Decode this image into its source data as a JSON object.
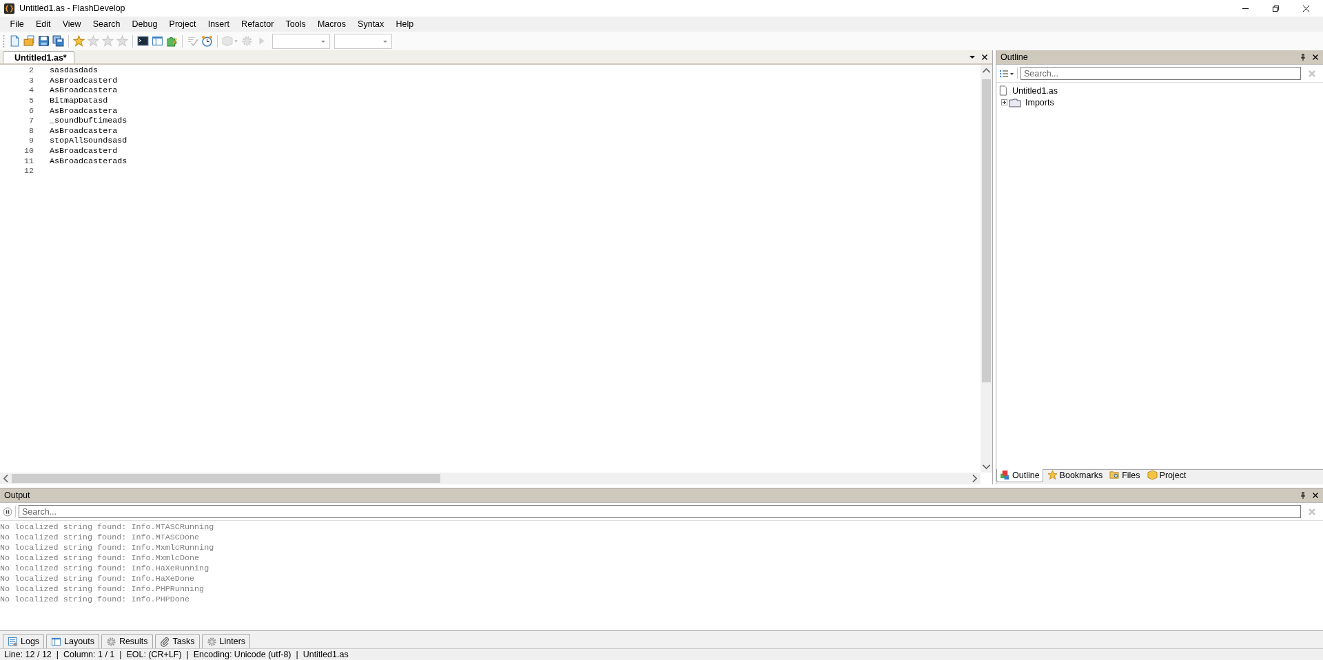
{
  "window": {
    "title": "Untitled1.as - FlashDevelop"
  },
  "menu": [
    "File",
    "Edit",
    "View",
    "Search",
    "Debug",
    "Project",
    "Insert",
    "Refactor",
    "Tools",
    "Macros",
    "Syntax",
    "Help"
  ],
  "toolbar": [
    {
      "kind": "new",
      "disabled": false
    },
    {
      "kind": "open",
      "disabled": false
    },
    {
      "kind": "save",
      "disabled": false
    },
    {
      "kind": "saveall",
      "disabled": false
    },
    {
      "kind": "sep"
    },
    {
      "kind": "star",
      "disabled": false
    },
    {
      "kind": "star",
      "disabled": true
    },
    {
      "kind": "star",
      "disabled": true
    },
    {
      "kind": "star",
      "disabled": true
    },
    {
      "kind": "sep"
    },
    {
      "kind": "terminal",
      "disabled": false
    },
    {
      "kind": "panel",
      "disabled": false
    },
    {
      "kind": "puzzle",
      "disabled": false
    },
    {
      "kind": "sep"
    },
    {
      "kind": "checklist",
      "disabled": true
    },
    {
      "kind": "clock",
      "disabled": false
    },
    {
      "kind": "sep"
    },
    {
      "kind": "box",
      "disabled": true
    },
    {
      "kind": "gear",
      "disabled": true
    },
    {
      "kind": "play",
      "disabled": true
    },
    {
      "kind": "combo"
    },
    {
      "kind": "combo"
    }
  ],
  "editor": {
    "tabs": [
      {
        "label": "Untitled1.as*",
        "selected": true
      }
    ],
    "lines": [
      {
        "number": "2",
        "text": "sasdasdads"
      },
      {
        "number": "3",
        "text": "AsBroadcasterd"
      },
      {
        "number": "4",
        "text": "AsBroadcastera"
      },
      {
        "number": "5",
        "text": "BitmapDatasd"
      },
      {
        "number": "6",
        "text": "AsBroadcastera"
      },
      {
        "number": "7",
        "text": "_soundbuftimeads"
      },
      {
        "number": "8",
        "text": "AsBroadcastera"
      },
      {
        "number": "9",
        "text": "stopAllSoundsasd"
      },
      {
        "number": "10",
        "text": "AsBroadcasterd"
      },
      {
        "number": "11",
        "text": "AsBroadcasterads"
      },
      {
        "number": "12"
      }
    ]
  },
  "outline": {
    "title": "Outline",
    "search": {
      "placeholder": "Search..."
    },
    "tree": [
      {
        "label": "Untitled1.as",
        "kind": "file",
        "children": [
          {
            "label": "Imports",
            "kind": "folder",
            "expanded": false
          }
        ]
      }
    ],
    "tabs": [
      {
        "label": "Outline",
        "kind": "cubes",
        "selected": true
      },
      {
        "label": "Bookmarks",
        "kind": "star",
        "selected": false
      },
      {
        "label": "Files",
        "kind": "folder",
        "selected": false
      },
      {
        "label": "Project",
        "kind": "box",
        "selected": false
      }
    ]
  },
  "output": {
    "title": "Output",
    "search": {
      "placeholder": "Search..."
    },
    "lines": [
      "No localized string found: Info.MTASCRunning",
      "No localized string found: Info.MTASCDone",
      "No localized string found: Info.MxmlcRunning",
      "No localized string found: Info.MxmlcDone",
      "No localized string found: Info.HaXeRunning",
      "No localized string found: Info.HaXeDone",
      "No localized string found: Info.PHPRunning",
      "No localized string found: Info.PHPDone"
    ]
  },
  "bottom_tabs": [
    {
      "label": "Logs",
      "kind": "logs",
      "selected": false
    },
    {
      "label": "Layouts",
      "kind": "panel",
      "selected": false
    },
    {
      "label": "Results",
      "kind": "gear",
      "selected": false
    },
    {
      "label": "Tasks",
      "kind": "clip",
      "selected": false
    },
    {
      "label": "Linters",
      "kind": "gear",
      "selected": false
    }
  ],
  "status_bar": "Line: 12 / 12  |  Column: 1 / 1  |  EOL: (CR+LF)  |  Encoding: Unicode (utf-8)  |  Untitled1.as"
}
